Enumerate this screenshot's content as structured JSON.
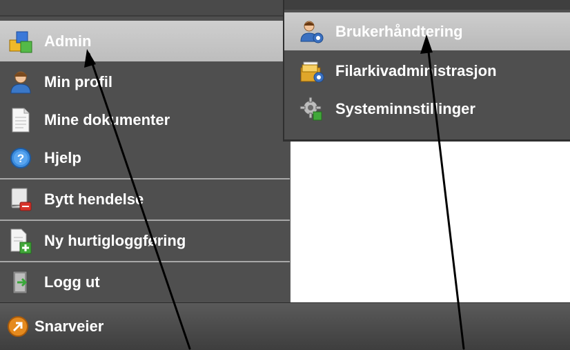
{
  "main_menu": {
    "items": [
      {
        "label": "Admin",
        "icon": "admin-cubes-icon",
        "active": true
      },
      {
        "label": "Min profil",
        "icon": "user-profile-icon"
      },
      {
        "label": "Mine dokumenter",
        "icon": "document-icon"
      },
      {
        "label": "Hjelp",
        "icon": "help-icon"
      },
      {
        "label": "Bytt hendelse",
        "icon": "switch-event-icon"
      },
      {
        "label": "Ny hurtigloggføring",
        "icon": "new-log-entry-icon"
      },
      {
        "label": "Logg ut",
        "icon": "logout-door-icon"
      }
    ]
  },
  "sub_menu": {
    "items": [
      {
        "label": "Brukerhåndtering",
        "icon": "user-management-icon",
        "active": true
      },
      {
        "label": "Filarkivadministrasjon",
        "icon": "file-archive-icon"
      },
      {
        "label": "Systeminnstillinger",
        "icon": "system-settings-gear-icon"
      }
    ]
  },
  "bottom_bar": {
    "label": "Snarveier",
    "icon": "shortcuts-arrow-icon"
  },
  "colors": {
    "menu_bg": "#4f4f4f",
    "active_bg": "#c6c6c6",
    "text": "#ffffff",
    "arrow": "#000000"
  }
}
